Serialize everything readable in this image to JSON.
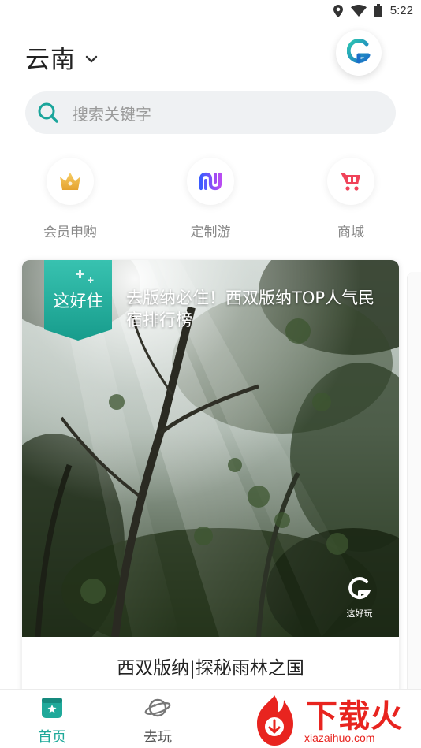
{
  "status_bar": {
    "time": "5:22"
  },
  "header": {
    "region": "云南"
  },
  "search": {
    "placeholder": "搜索关键字"
  },
  "quick_nav": [
    {
      "label": "会员申购",
      "icon": "crown-icon"
    },
    {
      "label": "定制游",
      "icon": "custom-tour-icon"
    },
    {
      "label": "商城",
      "icon": "shopping-cart-icon"
    }
  ],
  "card": {
    "badge": "这好住",
    "overlay_title": "去版纳必住！西双版纳TOP人气民宿排行榜",
    "watermark": "这好玩",
    "title": "西双版纳|探秘雨林之国"
  },
  "bottom_nav": [
    {
      "label": "首页",
      "active": true
    },
    {
      "label": "去玩",
      "active": false
    }
  ],
  "promo": {
    "name": "下载火",
    "url": "xiazaihuo.com"
  },
  "colors": {
    "accent": "#1fa99a",
    "brand_red": "#e8241f",
    "inactive": "#666666"
  }
}
